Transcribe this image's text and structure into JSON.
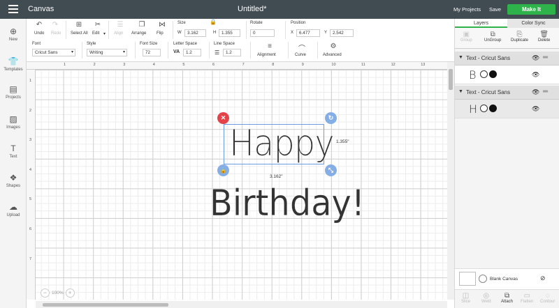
{
  "topbar": {
    "app_title": "Canvas",
    "doc_title": "Untitled*",
    "my_projects": "My Projects",
    "save": "Save",
    "make_it": "Make It"
  },
  "leftnav": [
    {
      "label": "New",
      "icon": "plus-icon"
    },
    {
      "label": "Templates",
      "icon": "shirt-icon"
    },
    {
      "label": "Projects",
      "icon": "projects-icon"
    },
    {
      "label": "Images",
      "icon": "image-icon"
    },
    {
      "label": "Text",
      "icon": "text-icon"
    },
    {
      "label": "Shapes",
      "icon": "shapes-icon"
    },
    {
      "label": "Upload",
      "icon": "cloud-upload-icon"
    }
  ],
  "toolbar": {
    "undo": "Undo",
    "redo": "Redo",
    "select_all": "Select All",
    "edit": "Edit",
    "align": "Align",
    "arrange": "Arrange",
    "flip": "Flip",
    "size_label": "Size",
    "w_label": "W",
    "w_value": "3.162",
    "h_label": "H",
    "h_value": "1.355",
    "rotate_label": "Rotate",
    "rotate_value": "0",
    "position_label": "Position",
    "x_label": "X",
    "x_value": "6.477",
    "y_label": "Y",
    "y_value": "2.542",
    "font_label": "Font",
    "font_value": "Cricut Sans",
    "style_label": "Style",
    "style_value": "Writing",
    "fontsize_label": "Font Size",
    "fontsize_value": "72",
    "letterspace_label": "Letter Space",
    "letterspace_value": "1.2",
    "linespace_label": "Line Space",
    "linespace_value": "1.2",
    "alignment": "Alignment",
    "curve": "Curve",
    "advanced": "Advanced"
  },
  "ruler": {
    "top": [
      "1",
      "2",
      "3",
      "4",
      "5",
      "6",
      "7",
      "8",
      "9",
      "10",
      "11",
      "12",
      "13"
    ],
    "left": [
      "1",
      "2",
      "3",
      "4",
      "5",
      "6",
      "7"
    ]
  },
  "canvas": {
    "line1": "Happy",
    "line2": "Birthday!",
    "width_dim": "3.162\"",
    "height_dim": "1.355\"",
    "zoom": "100%"
  },
  "rightpanel": {
    "tab_layers": "Layers",
    "tab_colorsync": "Color Sync",
    "actions": {
      "group": "Group",
      "ungroup": "UnGroup",
      "duplicate": "Duplicate",
      "delete": "Delete"
    },
    "layers": [
      {
        "name": "Text - Cricut Sans",
        "glyph": "B"
      },
      {
        "name": "Text - Cricut Sans",
        "glyph": "H"
      }
    ],
    "blank_canvas": "Blank Canvas",
    "bottom_actions": {
      "slice": "Slice",
      "weld": "Weld",
      "attach": "Attach",
      "flatten": "Flatten",
      "contour": "Contour"
    }
  }
}
